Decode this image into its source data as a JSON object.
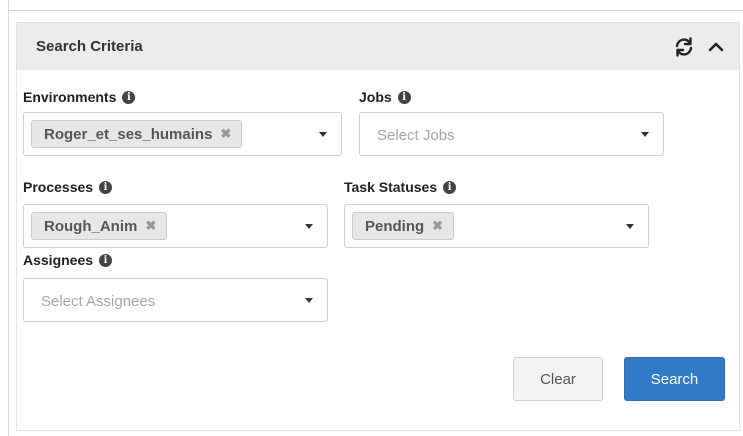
{
  "panel": {
    "title": "Search Criteria",
    "refresh_icon": "refresh-icon",
    "collapse_icon": "chevron-up-icon"
  },
  "fields": {
    "environments": {
      "label": "Environments",
      "tag": "Roger_et_ses_humains"
    },
    "jobs": {
      "label": "Jobs",
      "placeholder": "Select Jobs"
    },
    "processes": {
      "label": "Processes",
      "tag": "Rough_Anim"
    },
    "task_statuses": {
      "label": "Task Statuses",
      "tag": "Pending"
    },
    "assignees": {
      "label": "Assignees",
      "placeholder": "Select Assignees"
    }
  },
  "info_glyph": "i",
  "remove_glyph": "✖",
  "buttons": {
    "clear": "Clear",
    "search": "Search"
  },
  "colors": {
    "header_bg": "#ececec",
    "search_button": "#337ac6",
    "tag_bg": "#e7e7e7"
  }
}
